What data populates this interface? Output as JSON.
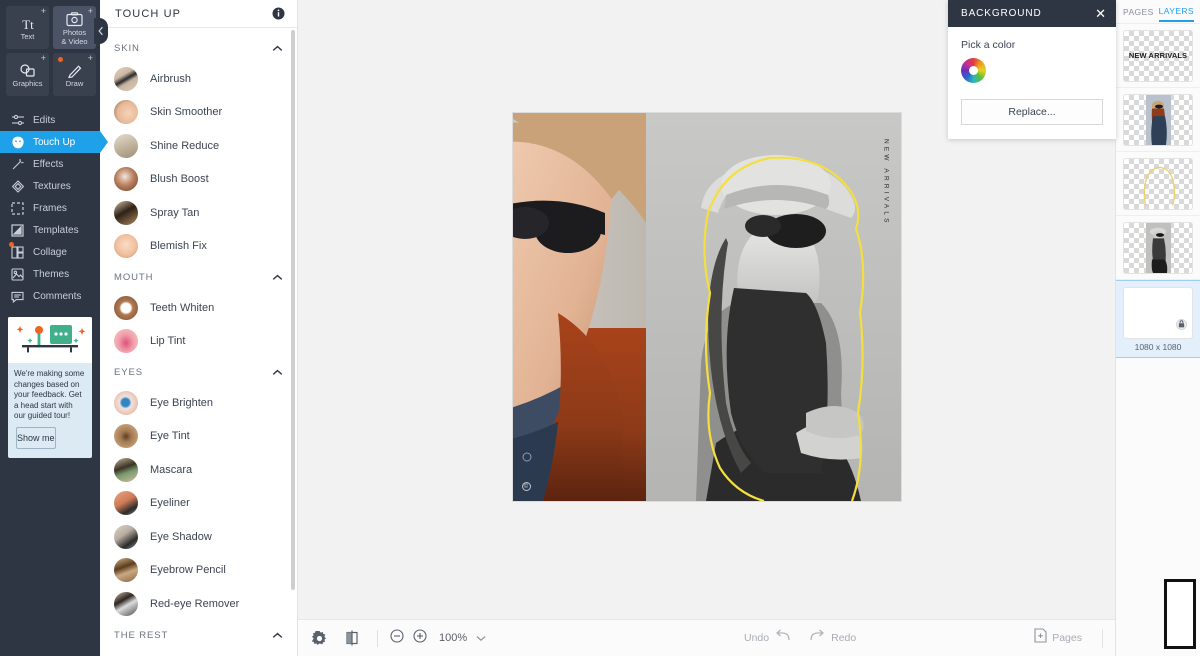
{
  "rail": {
    "tools": [
      {
        "label": "Text",
        "icon": "text-icon",
        "badge": "+",
        "dot": false,
        "active": false
      },
      {
        "label": "Photos\n& Video",
        "icon": "photos-video-icon",
        "badge": "+",
        "dot": false,
        "active": true
      },
      {
        "label": "Graphics",
        "icon": "graphics-icon",
        "badge": "+",
        "dot": false,
        "active": false
      },
      {
        "label": "Draw",
        "icon": "draw-icon",
        "badge": "+",
        "dot": true,
        "active": false
      }
    ],
    "nav": [
      {
        "label": "Edits",
        "icon": "sliders-icon",
        "selected": false,
        "dot": false
      },
      {
        "label": "Touch Up",
        "icon": "face-icon",
        "selected": true,
        "dot": false
      },
      {
        "label": "Effects",
        "icon": "wand-icon",
        "selected": false,
        "dot": false
      },
      {
        "label": "Textures",
        "icon": "diamond-icon",
        "selected": false,
        "dot": false
      },
      {
        "label": "Frames",
        "icon": "frame-icon",
        "selected": false,
        "dot": false
      },
      {
        "label": "Templates",
        "icon": "template-icon",
        "selected": false,
        "dot": false
      },
      {
        "label": "Collage",
        "icon": "collage-icon",
        "selected": false,
        "dot": true
      },
      {
        "label": "Themes",
        "icon": "themes-icon",
        "selected": false,
        "dot": false
      },
      {
        "label": "Comments",
        "icon": "comments-icon",
        "selected": false,
        "dot": false
      }
    ],
    "promo": {
      "text": "We're making some changes based on your feedback. Get a head start with our guided tour!",
      "button": "Show me"
    },
    "collapse_icon": "chevron-left-icon"
  },
  "panel": {
    "title": "TOUCH UP",
    "info_icon": "info-icon",
    "sections": [
      {
        "title": "SKIN",
        "collapse_icon": "chevron-up-icon",
        "items": [
          {
            "label": "Airbrush",
            "swatch": "#cbb7a4"
          },
          {
            "label": "Skin Smoother",
            "swatch": "#e6b99a"
          },
          {
            "label": "Shine Reduce",
            "swatch": "#c9bda9"
          },
          {
            "label": "Blush Boost",
            "swatch": "#9c6a50"
          },
          {
            "label": "Spray Tan",
            "swatch": "#6e5340"
          },
          {
            "label": "Blemish Fix",
            "swatch": "#f0c0a0"
          }
        ]
      },
      {
        "title": "MOUTH",
        "collapse_icon": "chevron-up-icon",
        "items": [
          {
            "label": "Teeth Whiten",
            "swatch": "#b07a53"
          },
          {
            "label": "Lip Tint",
            "swatch": "#e8a0a8"
          }
        ]
      },
      {
        "title": "EYES",
        "collapse_icon": "chevron-up-icon",
        "items": [
          {
            "label": "Eye Brighten",
            "swatch": "#d9a48e"
          },
          {
            "label": "Eye Tint",
            "swatch": "#9c7352"
          },
          {
            "label": "Mascara",
            "swatch": "#7d6a52"
          },
          {
            "label": "Eyeliner",
            "swatch": "#c9745a"
          },
          {
            "label": "Eye Shadow",
            "swatch": "#b8ada0"
          },
          {
            "label": "Eyebrow Pencil",
            "swatch": "#8a6642"
          },
          {
            "label": "Red-eye Remover",
            "swatch": "#70696b"
          }
        ]
      },
      {
        "title": "THE REST",
        "collapse_icon": "chevron-up-icon",
        "items": []
      }
    ]
  },
  "background_popup": {
    "title": "BACKGROUND",
    "close_icon": "close-icon",
    "pick_label": "Pick a color",
    "color_wheel_icon": "color-wheel-icon",
    "replace_label": "Replace..."
  },
  "canvas": {
    "artboard_text": "NEW ARRIVALS",
    "watermark": "©"
  },
  "layers": {
    "tabs": [
      {
        "label": "PAGES",
        "active": false
      },
      {
        "label": "LAYERS",
        "active": true
      }
    ],
    "close_icon": "close-icon",
    "rows": [
      {
        "type": "text",
        "text": "NEW ARRIVALS",
        "selected": false
      },
      {
        "type": "photo-color",
        "selected": false
      },
      {
        "type": "outline",
        "selected": false
      },
      {
        "type": "photo-bw",
        "selected": false
      },
      {
        "type": "background",
        "dimensions": "1080 x 1080",
        "lock_icon": "lock-icon",
        "selected": true
      }
    ]
  },
  "bottom_bar": {
    "settings_icon": "gear-icon",
    "compare_icon": "compare-icon",
    "zoom_out_icon": "zoom-out-icon",
    "zoom_in_icon": "zoom-in-icon",
    "zoom_level": "100%",
    "zoom_dropdown_icon": "chevron-down-icon",
    "undo_label": "Undo",
    "undo_icon": "undo-arrow-icon",
    "redo_icon": "redo-arrow-icon",
    "redo_label": "Redo",
    "pages_icon": "add-page-icon",
    "pages_label": "Pages"
  }
}
